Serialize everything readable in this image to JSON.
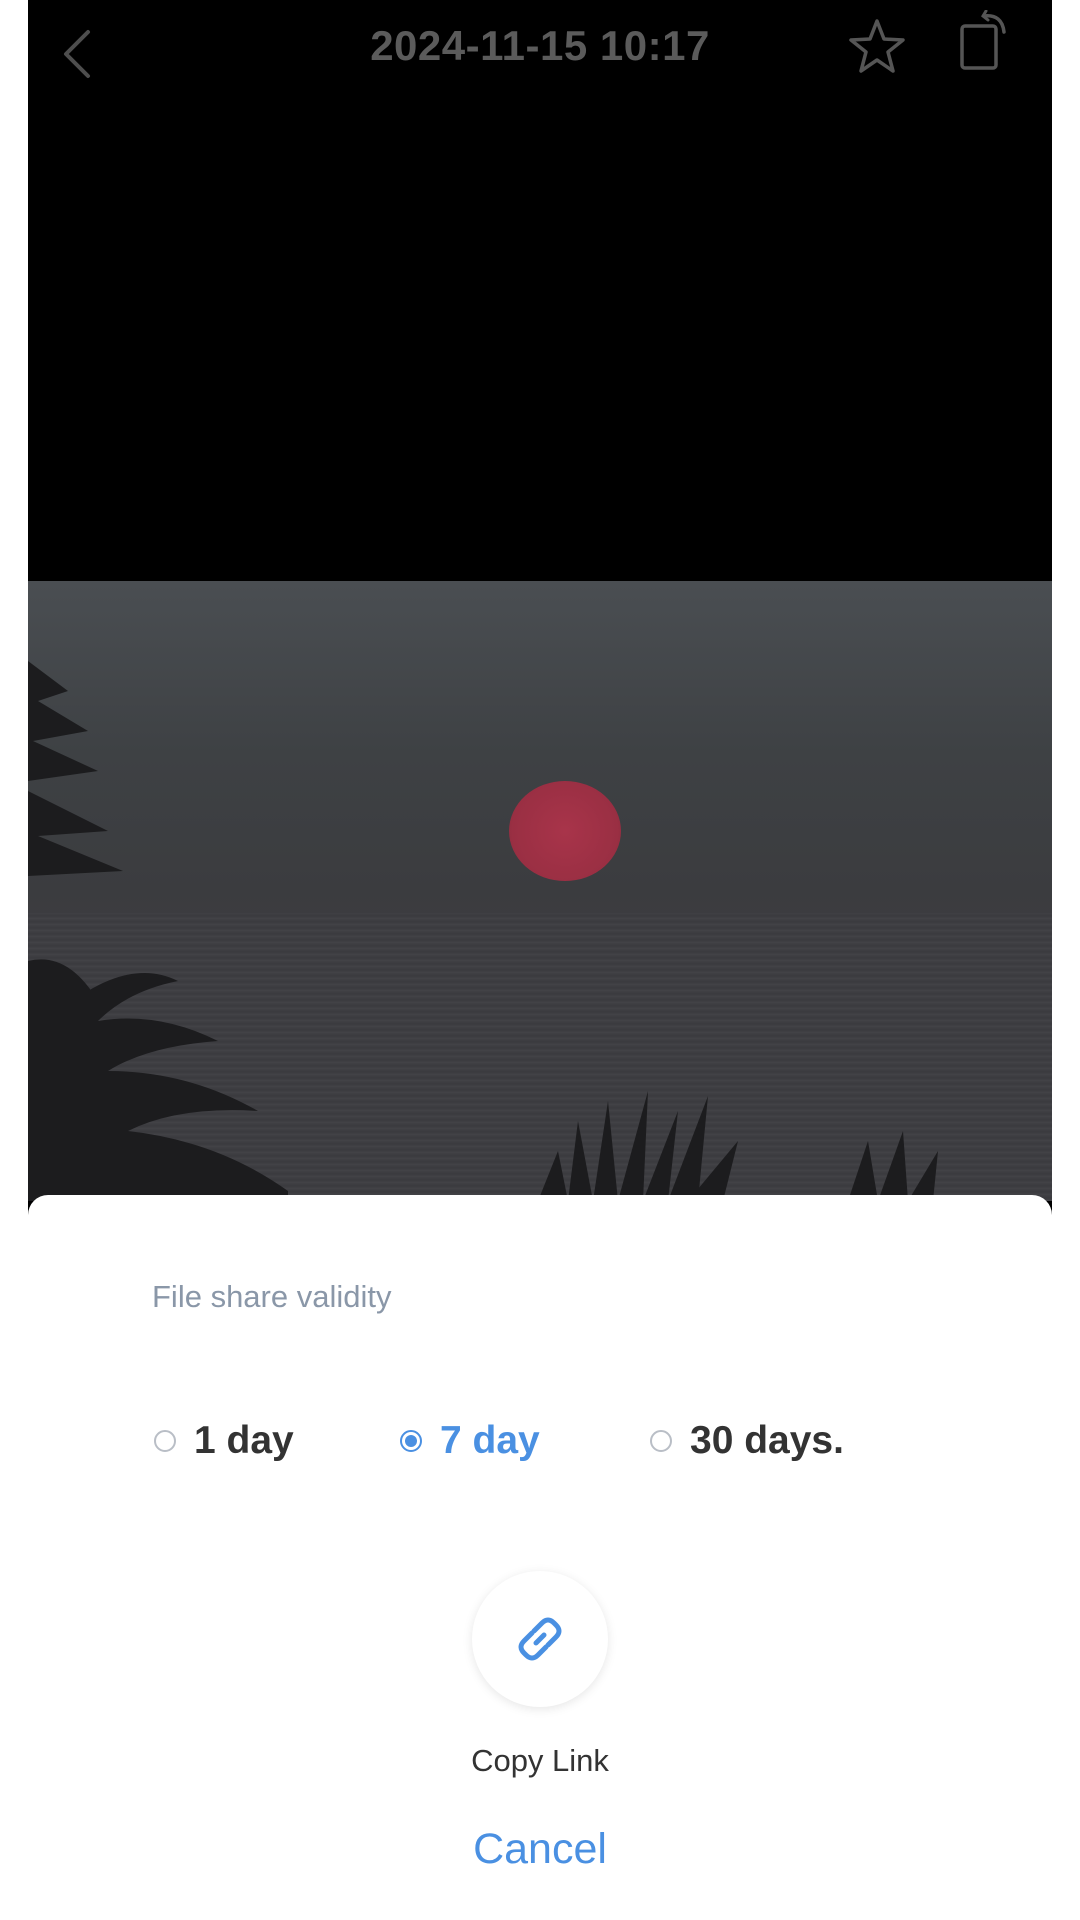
{
  "header": {
    "title": "2024-11-15 10:17",
    "back_icon": "chevron-left-icon",
    "favorite_icon": "star-icon",
    "rotate_icon": "rotate-icon"
  },
  "share_sheet": {
    "label": "File share validity",
    "options": [
      {
        "label": "1 day",
        "selected": false
      },
      {
        "label": "7 day",
        "selected": true
      },
      {
        "label": "30 days.",
        "selected": false
      }
    ],
    "copy_link_icon": "link-icon",
    "copy_link_label": "Copy Link",
    "cancel_label": "Cancel"
  },
  "colors": {
    "accent": "#4a90e2",
    "overlay": "#000000",
    "sheet_background": "#ffffff"
  }
}
